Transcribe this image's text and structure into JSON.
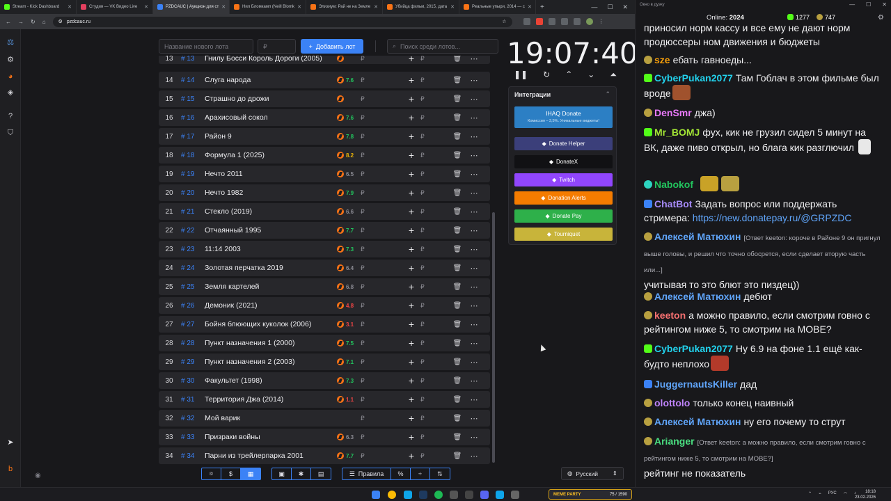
{
  "browser": {
    "tabs": [
      {
        "label": "Stream - Kick Dashboard",
        "color": "#53fc18"
      },
      {
        "label": "Студия — VK Видео Live",
        "color": "#e4405f"
      },
      {
        "label": "PZDCAUC | Аукцион для ст",
        "color": "#3b82f6",
        "active": true
      },
      {
        "label": "Нил Бломкамп (Neill Blomk",
        "color": "#f97316"
      },
      {
        "label": "Элизиум: Рай не на Земле",
        "color": "#f97316"
      },
      {
        "label": "Убийца фильм, 2015, дата",
        "color": "#f97316"
      },
      {
        "label": "Реальные упыри, 2014 — с",
        "color": "#f97316"
      }
    ],
    "url": "pzdcauc.ru"
  },
  "toolbar": {
    "new_lot_placeholder": "Название нового лота",
    "price_placeholder": "₽",
    "add_button": "Добавить лот",
    "search_placeholder": "Поиск среди лотов..."
  },
  "lots": [
    {
      "n": "13",
      "id": "# 13",
      "title": "Гнилу Босси Король Дороги (2005)",
      "rating": "",
      "rcolor": "#22c55e",
      "partial": true
    },
    {
      "n": "14",
      "id": "# 14",
      "title": "Слуга народа",
      "rating": "7.6",
      "rcolor": "#22c55e"
    },
    {
      "n": "15",
      "id": "# 15",
      "title": "Страшно до дрожи",
      "rating": "",
      "rcolor": "#8a8a92"
    },
    {
      "n": "16",
      "id": "# 16",
      "title": "Арахисовый сокол",
      "rating": "7.6",
      "rcolor": "#22c55e"
    },
    {
      "n": "17",
      "id": "# 17",
      "title": "Район 9",
      "rating": "7.8",
      "rcolor": "#22c55e"
    },
    {
      "n": "18",
      "id": "# 18",
      "title": "Формула 1 (2025)",
      "rating": "8.2",
      "rcolor": "#eab308"
    },
    {
      "n": "19",
      "id": "# 19",
      "title": "Нечто 2011",
      "rating": "6.5",
      "rcolor": "#8a8a92"
    },
    {
      "n": "20",
      "id": "# 20",
      "title": "Нечто 1982",
      "rating": "7.9",
      "rcolor": "#22c55e"
    },
    {
      "n": "21",
      "id": "# 21",
      "title": "Стекло (2019)",
      "rating": "6.6",
      "rcolor": "#8a8a92"
    },
    {
      "n": "22",
      "id": "# 22",
      "title": "Отчаянный 1995",
      "rating": "7.7",
      "rcolor": "#22c55e"
    },
    {
      "n": "23",
      "id": "# 23",
      "title": "11:14 2003",
      "rating": "7.3",
      "rcolor": "#22c55e"
    },
    {
      "n": "24",
      "id": "# 24",
      "title": "Золотая перчатка 2019",
      "rating": "6.4",
      "rcolor": "#8a8a92"
    },
    {
      "n": "25",
      "id": "# 25",
      "title": "Земля картелей",
      "rating": "6.8",
      "rcolor": "#8a8a92"
    },
    {
      "n": "26",
      "id": "# 26",
      "title": "Демоник (2021)",
      "rating": "4.8",
      "rcolor": "#ef4444"
    },
    {
      "n": "27",
      "id": "# 27",
      "title": "Бойня блюющих куколок (2006)",
      "rating": "3.1",
      "rcolor": "#ef4444"
    },
    {
      "n": "28",
      "id": "# 28",
      "title": "Пункт назначения 1 (2000)",
      "rating": "7.5",
      "rcolor": "#22c55e"
    },
    {
      "n": "29",
      "id": "# 29",
      "title": "Пункт назначения 2 (2003)",
      "rating": "7.1",
      "rcolor": "#22c55e"
    },
    {
      "n": "30",
      "id": "# 30",
      "title": "Факультет (1998)",
      "rating": "7.3",
      "rcolor": "#22c55e"
    },
    {
      "n": "31",
      "id": "# 31",
      "title": "Территория Джа (2014)",
      "rating": "1.1",
      "rcolor": "#ef4444"
    },
    {
      "n": "32",
      "id": "# 32",
      "title": "Мой варик",
      "rating": "",
      "rcolor": "#8a8a92",
      "nokp": true
    },
    {
      "n": "33",
      "id": "# 33",
      "title": "Призраки войны",
      "rating": "6.3",
      "rcolor": "#8a8a92"
    },
    {
      "n": "34",
      "id": "# 34",
      "title": "Парни из трейлерпарка 2001",
      "rating": "7.7",
      "rcolor": "#22c55e"
    }
  ],
  "currency": "₽",
  "clock": "19:07:40",
  "integrations": {
    "title": "Интеграции",
    "ihaq_title": "IHAQ Donate",
    "ihaq_sub": "Комиссия – 3,5%. Уникальные виджеты!",
    "buttons": [
      {
        "label": "Donate Helper",
        "color": "#3b3f7a"
      },
      {
        "label": "DonateX",
        "color": "#111114"
      },
      {
        "label": "Twitch",
        "color": "#9146ff"
      },
      {
        "label": "Donation Alerts",
        "color": "#f57c00"
      },
      {
        "label": "Donate Pay",
        "color": "#2eb04a"
      },
      {
        "label": "Tourniquet",
        "color": "#c8b43a"
      }
    ]
  },
  "bottom": {
    "rules": "Правила",
    "percent": "%",
    "language": "Русский"
  },
  "chat": {
    "window_title": "Окно в дуэку",
    "online_label": "Online:",
    "online_count": "2024",
    "count1": "1277",
    "count2": "747",
    "messages": [
      {
        "nick": "",
        "text": "приносил норм кассу и все ему не дают норм продюссеры ном движения и бюджеты",
        "ncolor": "#fff"
      },
      {
        "nick": "sze",
        "text": "ебать гавноеды...",
        "ncolor": "#f59e0b"
      },
      {
        "nick": "CyberPukan2077",
        "text": "Там Гоблач в этом фильме был вроде",
        "ncolor": "#22d3ee"
      },
      {
        "nick": "DenSmr",
        "text": "джа)",
        "ncolor": "#e879f9"
      },
      {
        "nick": "Mr_BOMJ",
        "text": "фух, кик не грузил сидел 5 минут на ВК, даже пиво открыл, но блага кик разглючил",
        "ncolor": "#a3e635"
      },
      {
        "nick": "Nabokof",
        "text": "",
        "ncolor": "#22c55e"
      },
      {
        "nick": "ChatBot",
        "text": "Задать вопрос или поддержать стримера:",
        "link": "https://new.donatepay.ru/@GRPZDC",
        "ncolor": "#a78bfa"
      },
      {
        "nick": "Алексей Матюхин",
        "reply": "[Ответ keeton: короче в Районе 9 он пригнул выше головы, и решил что точно обосрется, если сделает вторую часть или...]",
        "text": "учитывая то это блют это пиздец))",
        "ncolor": "#60a5fa"
      },
      {
        "nick": "Алексей Матюхин",
        "text": "дебют",
        "ncolor": "#60a5fa"
      },
      {
        "nick": "keeton",
        "text": "а можно правило, если смотрим говно с рейтингом ниже 5, то смотрим на МОВЕ?",
        "ncolor": "#f87171"
      },
      {
        "nick": "CyberPukan2077",
        "text": "Ну 6.9 на фоне 1.1 ещё как-будто неплохо",
        "ncolor": "#22d3ee"
      },
      {
        "nick": "JuggernautsKiller",
        "text": "дад",
        "ncolor": "#60a5fa"
      },
      {
        "nick": "olottolo",
        "text": "только конец наивный",
        "ncolor": "#c084fc"
      },
      {
        "nick": "Алексей Матюхин",
        "text": "ну его почему то струт",
        "ncolor": "#60a5fa"
      },
      {
        "nick": "Arianger",
        "reply": "[Ответ keeton: а можно правило, если смотрим говно с рейтингом ниже 5, то смотрим на МОВЕ?]",
        "text": "рейтинг не показатель",
        "ncolor": "#4ade80"
      }
    ]
  },
  "taskbar": {
    "meme_label": "MEME PARTY",
    "meme_count": "75 / 1590",
    "lang": "РУС",
    "time": "18:18",
    "date": "23.02.2026"
  }
}
